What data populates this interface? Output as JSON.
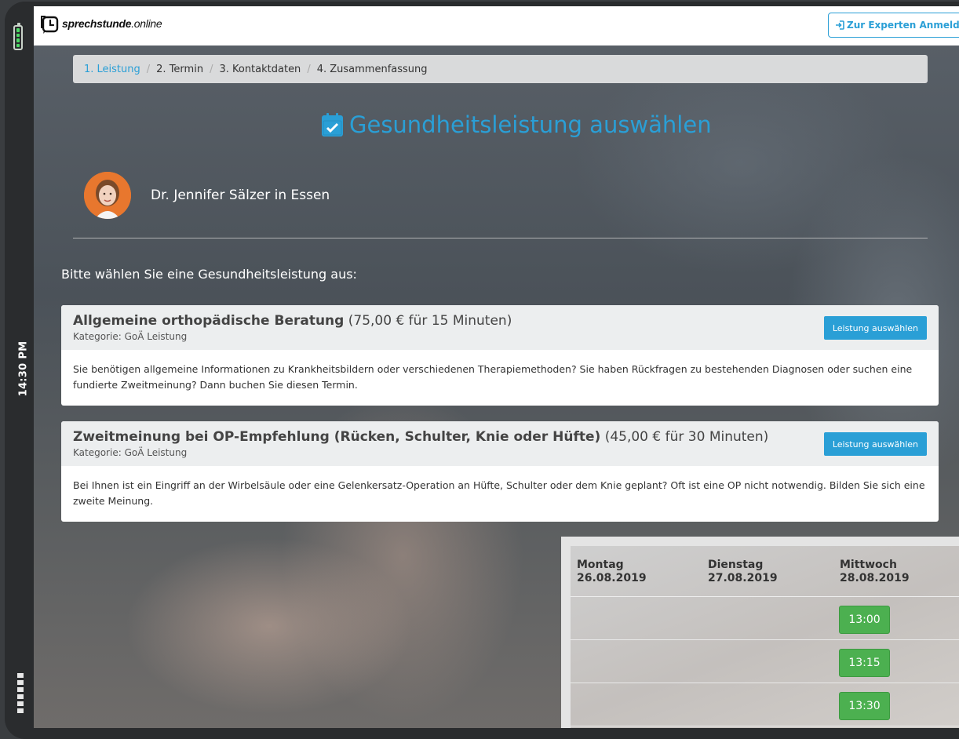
{
  "device": {
    "time": "14:30 PM"
  },
  "header": {
    "logo_bold": "sprechstunde",
    "logo_light": ".online",
    "expert_login": "Zur Experten Anmeldung"
  },
  "breadcrumb": [
    {
      "label": "1. Leistung",
      "active": true
    },
    {
      "label": "2. Termin",
      "active": false
    },
    {
      "label": "3. Kontaktdaten",
      "active": false
    },
    {
      "label": "4. Zusammenfassung",
      "active": false
    }
  ],
  "title": "Gesundheitsleistung auswählen",
  "doctor": {
    "name": "Dr. Jennifer Sälzer in Essen"
  },
  "prompt": "Bitte wählen Sie eine Gesundheitsleistung aus:",
  "services": [
    {
      "name": "Allgemeine orthopädische Beratung",
      "price": "(75,00 € für 15 Minuten)",
      "category": "Kategorie: GoÄ Leistung",
      "button": "Leistung auswählen",
      "description": "Sie benötigen allgemeine Informationen zu Krankheitsbildern oder verschiedenen Therapiemethoden? Sie haben Rückfragen zu bestehenden Diagnosen oder suchen eine fundierte Zweitmeinung? Dann buchen Sie diesen Termin."
    },
    {
      "name": "Zweitmeinung bei OP-Empfehlung (Rücken, Schulter, Knie oder Hüfte)",
      "price": "(45,00 € für 30 Minuten)",
      "category": "Kategorie: GoÄ Leistung",
      "button": "Leistung auswählen",
      "description": "Bei Ihnen ist ein Eingriff an der Wirbelsäule oder eine Gelenkersatz-Operation an Hüfte, Schulter oder dem Knie geplant? Oft ist eine OP nicht notwendig. Bilden Sie sich eine zweite Meinung."
    }
  ],
  "calendar": {
    "days": [
      {
        "weekday": "Montag",
        "date": "26.08.2019"
      },
      {
        "weekday": "Dienstag",
        "date": "27.08.2019"
      },
      {
        "weekday": "Mittwoch",
        "date": "28.08.2019"
      }
    ],
    "slots": [
      "13:00",
      "13:15",
      "13:30"
    ]
  },
  "colors": {
    "accent": "#2a9fd6",
    "slot_green": "#4cb050",
    "battery_green": "#4cd964"
  }
}
